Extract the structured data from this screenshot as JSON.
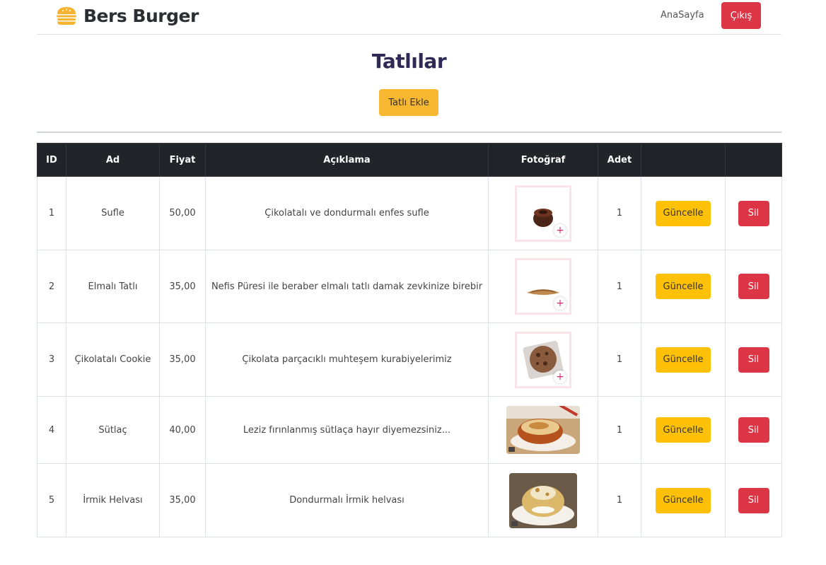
{
  "header": {
    "brand": "Bers Burger",
    "brand_icon": "burger-icon",
    "nav_home": "AnaSayfa",
    "logout_label": "Çıkış"
  },
  "page": {
    "title": "Tatlılar",
    "add_button": "Tatlı Ekle"
  },
  "table": {
    "columns": [
      "ID",
      "Ad",
      "Fiyat",
      "Açıklama",
      "Fotoğraf",
      "Adet",
      "",
      ""
    ],
    "update_label": "Güncelle",
    "delete_label": "Sil",
    "rows": [
      {
        "id": "1",
        "name": "Sufle",
        "price": "50,00",
        "desc": "Çikolatalı ve dondurmalı enfes sufle",
        "qty": "1",
        "photo": "souffle-photo"
      },
      {
        "id": "2",
        "name": "Elmalı Tatlı",
        "price": "35,00",
        "desc": "Nefis Püresi ile beraber elmalı tatlı damak zevkinize birebir",
        "qty": "1",
        "photo": "apple-dessert-photo"
      },
      {
        "id": "3",
        "name": "Çikolatalı Cookie",
        "price": "35,00",
        "desc": "Çikolata parçacıklı muhteşem kurabiyelerimiz",
        "qty": "1",
        "photo": "cookie-photo"
      },
      {
        "id": "4",
        "name": "Sütlaç",
        "price": "40,00",
        "desc": "Leziz fırınlanmış sütlaça hayır diyemezsiniz...",
        "qty": "1",
        "photo": "rice-pudding-photo"
      },
      {
        "id": "5",
        "name": "İrmik Helvası",
        "price": "35,00",
        "desc": "Dondurmalı İrmik helvası",
        "qty": "1",
        "photo": "semolina-halva-photo"
      }
    ]
  },
  "colors": {
    "primary_danger": "#dc3545",
    "warning": "#ffc107",
    "accent_orange": "#f7b731",
    "table_head": "#212529",
    "title": "#2d2a55"
  }
}
